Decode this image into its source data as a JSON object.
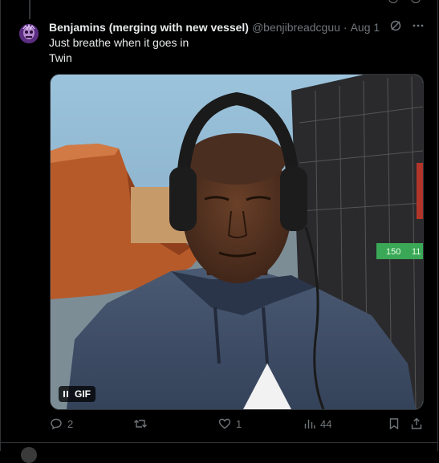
{
  "tweet": {
    "display_name": "Benjamins (merging with new vessel)",
    "handle": "@benjibreadcguu",
    "separator": "·",
    "date": "Aug 1",
    "text_line1": "Just breathe when it goes in",
    "text_line2": "Twin"
  },
  "media": {
    "gif_label": "GIF",
    "overlay_numbers": [
      "150",
      "11"
    ]
  },
  "actions": {
    "replies": "2",
    "reposts": "",
    "likes": "1",
    "views": "44"
  },
  "colors": {
    "background": "#000000",
    "text_primary": "#e7e9ea",
    "text_secondary": "#71767b",
    "border": "#2f3336"
  }
}
